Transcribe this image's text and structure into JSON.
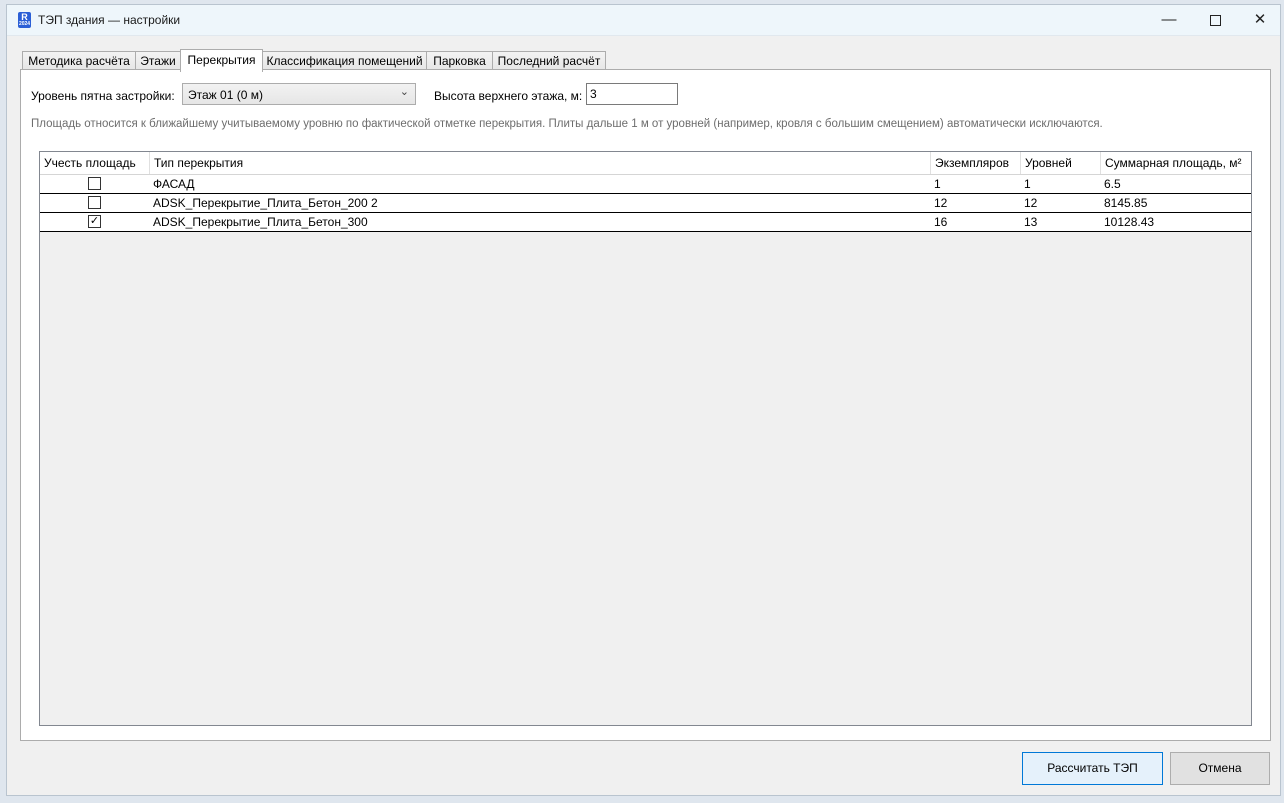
{
  "window": {
    "title": "ТЭП здания — настройки",
    "icon_letter": "R",
    "icon_sub": "2024",
    "minimize_glyph": "—",
    "close_glyph": "✕"
  },
  "tabs": [
    {
      "label": "Методика расчёта"
    },
    {
      "label": "Этажи"
    },
    {
      "label": "Перекрытия"
    },
    {
      "label": "Классификация помещений"
    },
    {
      "label": "Парковка"
    },
    {
      "label": "Последний расчёт"
    }
  ],
  "active_tab": "Перекрытия",
  "form": {
    "level_label": "Уровень пятна застройки:",
    "level_value": "Этаж 01 (0 м)",
    "combo_arrow": "⌄",
    "height_label": "Высота верхнего этажа, м:",
    "height_value": "3",
    "hint": "Площадь относится к ближайшему учитываемому уровню по фактической отметке перекрытия. Плиты дальше 1 м от уровней (например, кровля с большим смещением) автоматически исключаются."
  },
  "table": {
    "headers": [
      "Учесть площадь",
      "Тип перекрытия",
      "Экземпляров",
      "Уровней",
      "Суммарная площадь, м²"
    ],
    "check_glyph": "✓",
    "rows": [
      {
        "checked": false,
        "type": "ФАСАД",
        "instances": "1",
        "levels": "1",
        "area": "6.5"
      },
      {
        "checked": false,
        "type": "ADSK_Перекрытие_Плита_Бетон_200 2",
        "instances": "12",
        "levels": "12",
        "area": "8145.85"
      },
      {
        "checked": true,
        "type": "ADSK_Перекрытие_Плита_Бетон_300",
        "instances": "16",
        "levels": "13",
        "area": "10128.43"
      }
    ]
  },
  "buttons": {
    "calculate": "Рассчитать ТЭП",
    "cancel": "Отмена"
  },
  "colors": {
    "accent": "#0078d7",
    "icon_blue": "#2b5fd6"
  }
}
